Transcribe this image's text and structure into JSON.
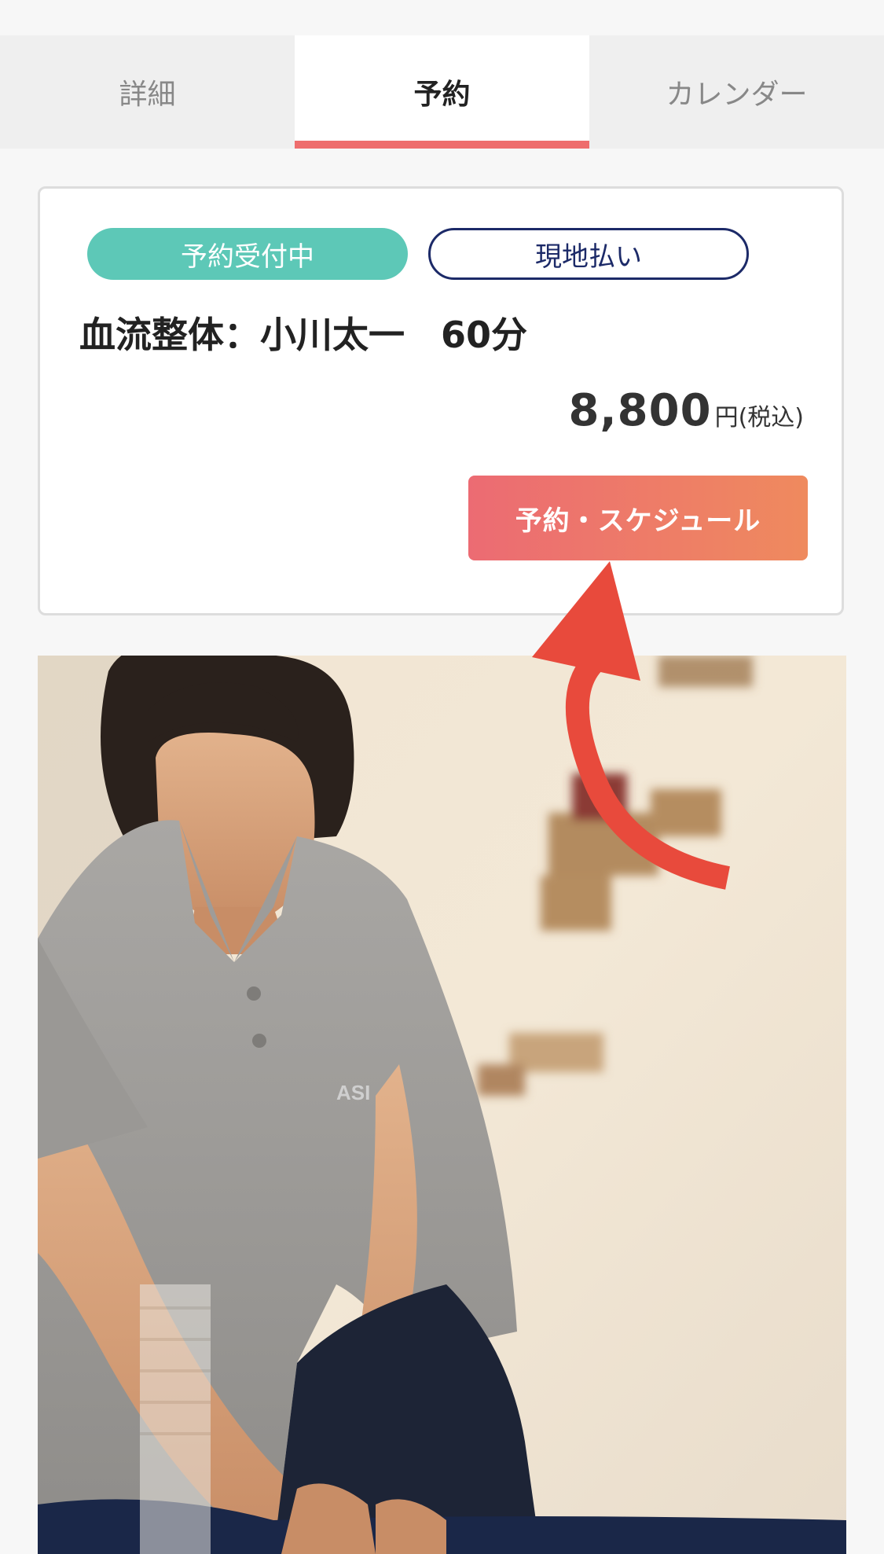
{
  "tabs": [
    {
      "label": "詳細"
    },
    {
      "label": "予約"
    },
    {
      "label": "カレンダー"
    }
  ],
  "active_tab": "予約",
  "card": {
    "status_badge": "予約受付中",
    "payment_badge": "現地払い",
    "title": "血流整体：小川太一　60分",
    "price": {
      "amount": "8,800",
      "unit": "円",
      "tax": "(税込)"
    },
    "button_label": "予約・スケジュール"
  },
  "photo": {
    "shirt_logo": "ASI"
  },
  "colors": {
    "accent_tab": "#ee6d6d",
    "status_green": "#5dc8b7",
    "payment_navy": "#1c2a68",
    "cta_start": "#ec6b73",
    "cta_end": "#ef8a5e",
    "arrow_red": "#e84a3c"
  },
  "icons": {
    "annotation": "curved-arrow-icon"
  }
}
